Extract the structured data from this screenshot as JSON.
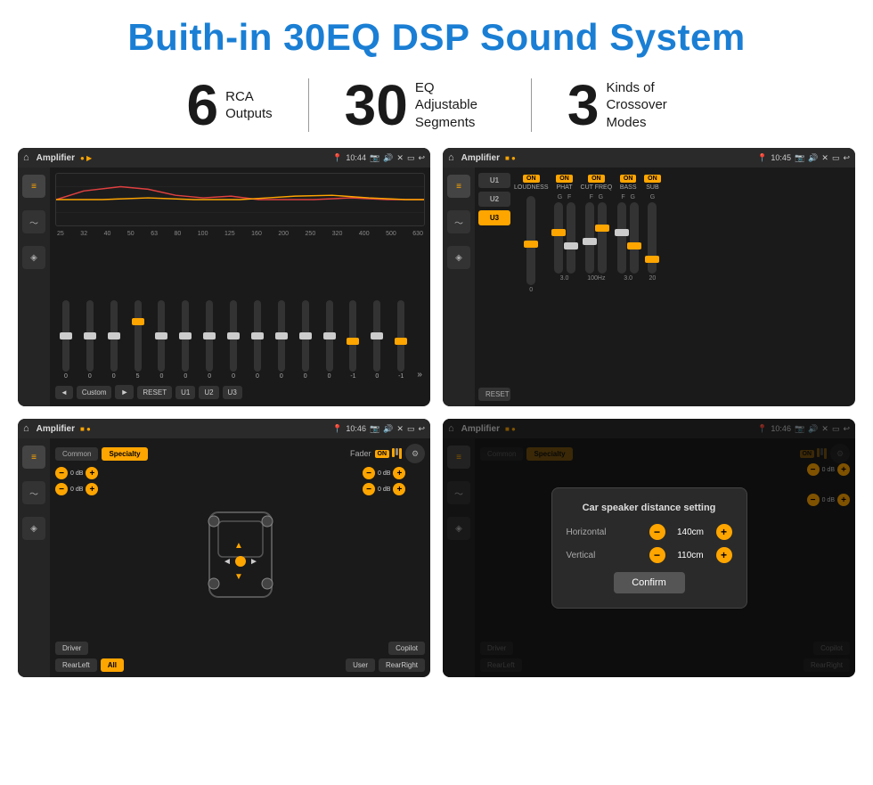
{
  "header": {
    "title": "Buith-in 30EQ DSP Sound System"
  },
  "stats": [
    {
      "number": "6",
      "label": "RCA\nOutputs"
    },
    {
      "number": "30",
      "label": "EQ Adjustable\nSegments"
    },
    {
      "number": "3",
      "label": "Kinds of\nCrossover Modes"
    }
  ],
  "screens": [
    {
      "id": "eq-screen",
      "status_bar": {
        "app": "Amplifier",
        "time": "10:44",
        "icons": "🏠"
      },
      "freq_labels": [
        "25",
        "32",
        "40",
        "50",
        "63",
        "80",
        "100",
        "125",
        "160",
        "200",
        "250",
        "320",
        "400",
        "500",
        "630"
      ],
      "slider_values": [
        "0",
        "0",
        "0",
        "5",
        "0",
        "0",
        "0",
        "0",
        "0",
        "0",
        "0",
        "0",
        "-1",
        "0",
        "-1"
      ],
      "bottom_buttons": [
        "◄",
        "Custom",
        "►",
        "RESET",
        "U1",
        "U2",
        "U3"
      ]
    },
    {
      "id": "crossover-screen",
      "status_bar": {
        "app": "Amplifier",
        "time": "10:45"
      },
      "presets": [
        "U1",
        "U2",
        "U3"
      ],
      "controls": [
        {
          "label": "LOUDNESS",
          "on": true
        },
        {
          "label": "PHAT",
          "on": true
        },
        {
          "label": "CUT FREQ",
          "on": true
        },
        {
          "label": "BASS",
          "on": true
        },
        {
          "label": "SUB",
          "on": true
        }
      ],
      "reset_label": "RESET"
    },
    {
      "id": "fader-screen",
      "status_bar": {
        "app": "Amplifier",
        "time": "10:46"
      },
      "tabs": [
        "Common",
        "Specialty"
      ],
      "fader_label": "Fader",
      "db_values": [
        "0 dB",
        "0 dB",
        "0 dB",
        "0 dB"
      ],
      "bottom_btns": [
        "Driver",
        "Copilot",
        "RearLeft",
        "All",
        "User",
        "RearRight"
      ]
    },
    {
      "id": "distance-screen",
      "status_bar": {
        "app": "Amplifier",
        "time": "10:46"
      },
      "tabs": [
        "Common",
        "Specialty"
      ],
      "dialog": {
        "title": "Car speaker distance setting",
        "fields": [
          {
            "label": "Horizontal",
            "value": "140cm"
          },
          {
            "label": "Vertical",
            "value": "110cm"
          }
        ],
        "confirm_label": "Confirm"
      },
      "db_values": [
        "0 dB",
        "0 dB"
      ],
      "bottom_btns": [
        "Driver",
        "Copilot",
        "RearLeft",
        "All",
        "User",
        "RearRight"
      ]
    }
  ]
}
